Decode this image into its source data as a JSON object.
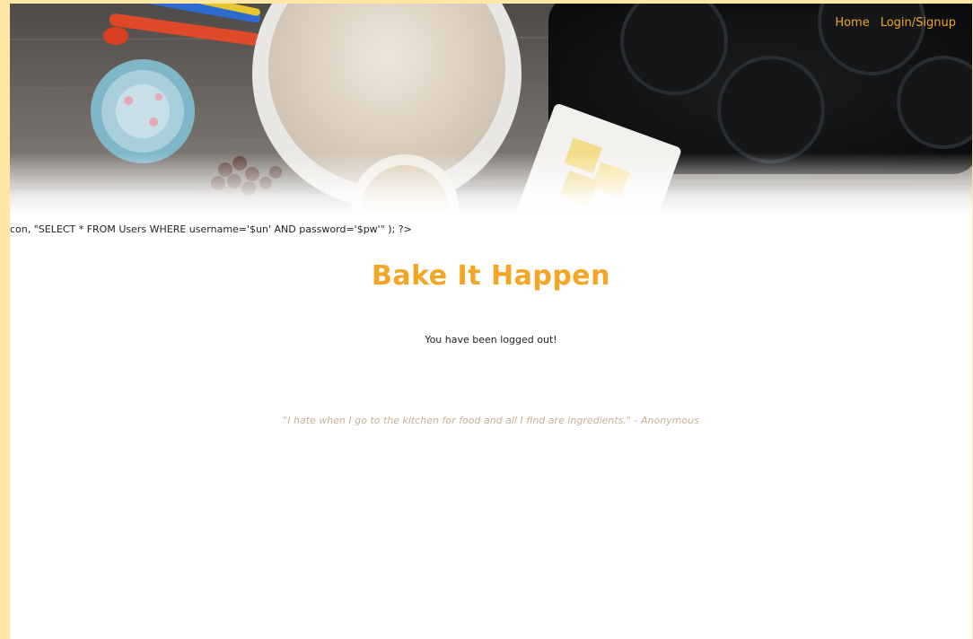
{
  "nav": {
    "home_label": "Home",
    "login_label": "Login/Signup"
  },
  "banner": {
    "code_text": "con, \"SELECT * FROM Users WHERE username='$un' AND password='$pw'\" ); ?>"
  },
  "main": {
    "title": "Bake It Happen",
    "message": "You have been logged out!",
    "quote": "\"I hate when I go to the kitchen for food and all I find are ingredients.\" - Anonymous"
  },
  "colors": {
    "accent": "#f5a524",
    "page_border": "#ffe8a6",
    "quote": "#c9b192"
  }
}
